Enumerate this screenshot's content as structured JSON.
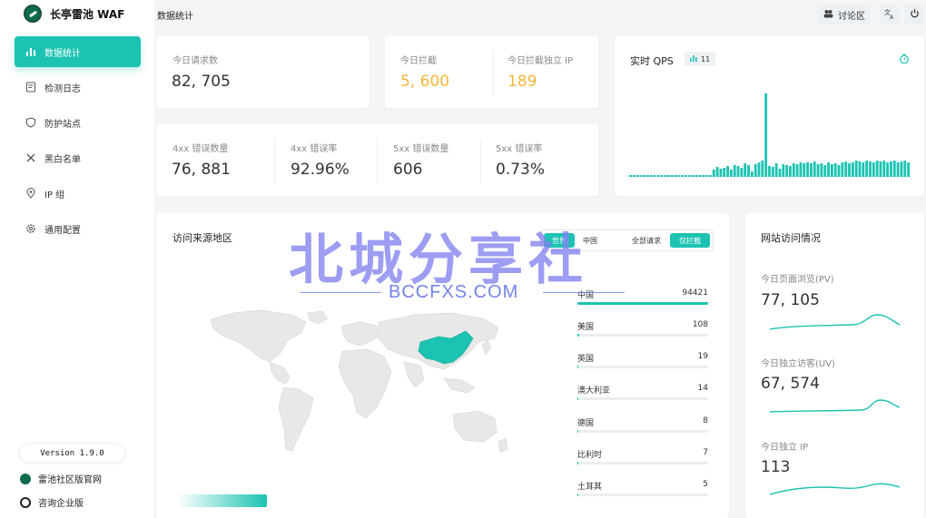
{
  "brand": {
    "name": "长亭雷池 WAF"
  },
  "header": {
    "title": "数据统计",
    "forum_label": "讨论区"
  },
  "nav": [
    {
      "label": "数据统计",
      "icon": "bar-chart-icon",
      "active": true
    },
    {
      "label": "检测日志",
      "icon": "log-icon",
      "active": false
    },
    {
      "label": "防护站点",
      "icon": "shield-icon",
      "active": false
    },
    {
      "label": "黑白名单",
      "icon": "tools-icon",
      "active": false
    },
    {
      "label": "IP 组",
      "icon": "location-icon",
      "active": false
    },
    {
      "label": "通用配置",
      "icon": "gear-icon",
      "active": false
    }
  ],
  "version": "Version 1.9.0",
  "footer_links": {
    "community": "雷池社区版官网",
    "enterprise": "咨询企业版"
  },
  "stats": {
    "requests": {
      "label": "今日请求数",
      "value": "82, 705"
    },
    "blocked": {
      "label": "今日拦截",
      "value": "5, 600"
    },
    "blocked_ip": {
      "label": "今日拦截独立 IP",
      "value": "189"
    },
    "err4xx_count": {
      "label": "4xx 错误数量",
      "value": "76, 881"
    },
    "err4xx_rate": {
      "label": "4xx 错误率",
      "value": "92.96%"
    },
    "err5xx_count": {
      "label": "5xx 错误数量",
      "value": "606"
    },
    "err5xx_rate": {
      "label": "5xx 错误率",
      "value": "0.73%"
    }
  },
  "qps": {
    "title": "实时 QPS",
    "badge": "11",
    "accent": "#1cc3b2",
    "values": [
      2,
      2,
      2,
      2,
      2,
      2,
      2,
      2,
      2,
      2,
      2,
      2,
      2,
      2,
      2,
      2,
      2,
      2,
      2,
      2,
      2,
      2,
      2,
      2,
      8,
      11,
      9,
      10,
      12,
      8,
      13,
      12,
      10,
      15,
      13,
      6,
      14,
      16,
      18,
      92,
      12,
      11,
      15,
      9,
      14,
      13,
      12,
      15,
      14,
      16,
      15,
      16,
      15,
      17,
      14,
      15,
      13,
      16,
      14,
      15,
      13,
      16,
      17,
      15,
      16,
      18,
      17,
      16,
      18,
      17,
      16,
      18,
      17,
      18,
      16,
      17,
      18,
      16,
      17,
      18,
      16
    ]
  },
  "region": {
    "title": "访问来源地区",
    "tabs": {
      "world": "世界",
      "china": "中国",
      "all": "全部请求",
      "blocked": "仅拦截"
    },
    "countries": [
      {
        "name": "中国",
        "count": "94421",
        "share": 1.0
      },
      {
        "name": "美国",
        "count": "108",
        "share": 0.012
      },
      {
        "name": "英国",
        "count": "19",
        "share": 0.004
      },
      {
        "name": "澳大利亚",
        "count": "14",
        "share": 0.003
      },
      {
        "name": "德国",
        "count": "8",
        "share": 0.002
      },
      {
        "name": "比利时",
        "count": "7",
        "share": 0.002
      },
      {
        "name": "土耳其",
        "count": "5",
        "share": 0.001
      }
    ]
  },
  "visits": {
    "title": "网站访问情况",
    "pv": {
      "label": "今日页面浏览(PV)",
      "value": "77, 105"
    },
    "uv": {
      "label": "今日独立访客(UV)",
      "value": "67, 574"
    },
    "ip": {
      "label": "今日独立 IP",
      "value": "113"
    }
  },
  "watermark": {
    "main": "北城分享社",
    "sub": "BCCFXS.COM"
  }
}
